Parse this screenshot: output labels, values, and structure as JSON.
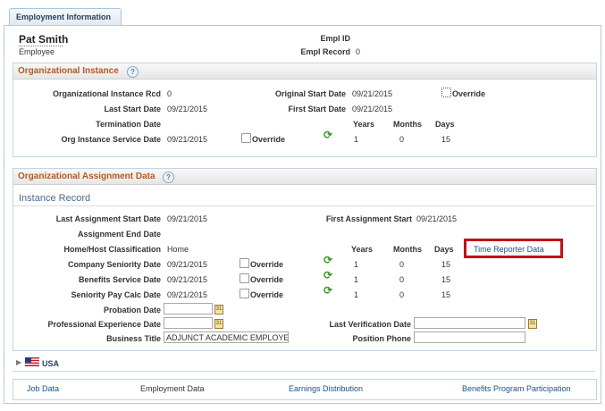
{
  "tab": {
    "label": "Employment Information"
  },
  "employee": {
    "name": "Pat Smith",
    "role": "Employee",
    "empl_id_label": "Empl ID",
    "empl_id_value": "",
    "empl_record_label": "Empl Record",
    "empl_record_value": "0"
  },
  "org_instance": {
    "title": "Organizational Instance",
    "rcd_label": "Organizational Instance Rcd",
    "rcd_value": "0",
    "orig_start_label": "Original Start Date",
    "orig_start_value": "09/21/2015",
    "override_label": "Override",
    "last_start_label": "Last Start Date",
    "last_start_value": "09/21/2015",
    "first_start_label": "First Start Date",
    "first_start_value": "09/21/2015",
    "termination_label": "Termination Date",
    "years_label": "Years",
    "months_label": "Months",
    "days_label": "Days",
    "service_label": "Org Instance Service Date",
    "service_value": "09/21/2015",
    "years_value": "1",
    "months_value": "0",
    "days_value": "15"
  },
  "org_assignment": {
    "title": "Organizational Assignment Data",
    "instance_record_label": "Instance Record",
    "last_assign_label": "Last Assignment Start Date",
    "last_assign_value": "09/21/2015",
    "first_assign_label": "First Assignment Start",
    "first_assign_value": "09/21/2015",
    "assign_end_label": "Assignment End Date",
    "home_host_label": "Home/Host Classification",
    "home_host_value": "Home",
    "years_label": "Years",
    "months_label": "Months",
    "days_label": "Days",
    "time_reporter_link": "Time Reporter Data",
    "override_label": "Override",
    "rows": [
      {
        "label": "Company Seniority Date",
        "date": "09/21/2015",
        "years": "1",
        "months": "0",
        "days": "15"
      },
      {
        "label": "Benefits Service Date",
        "date": "09/21/2015",
        "years": "1",
        "months": "0",
        "days": "15"
      },
      {
        "label": "Seniority Pay Calc Date",
        "date": "09/21/2015",
        "years": "1",
        "months": "0",
        "days": "15"
      }
    ],
    "probation_label": "Probation Date",
    "prof_exp_label": "Professional Experience Date",
    "last_verif_label": "Last Verification Date",
    "business_title_label": "Business Title",
    "business_title_value": "ADJUNCT ACADEMIC EMPLOYEE",
    "position_phone_label": "Position Phone"
  },
  "country": {
    "label": "USA"
  },
  "footer_links": {
    "job_data": "Job Data",
    "employment_data": "Employment Data",
    "earnings": "Earnings Distribution",
    "benefits": "Benefits Program Participation"
  },
  "colors": {
    "section_title": "#b45a26",
    "link": "#1e4f8e",
    "highlight": "#c40e14"
  }
}
